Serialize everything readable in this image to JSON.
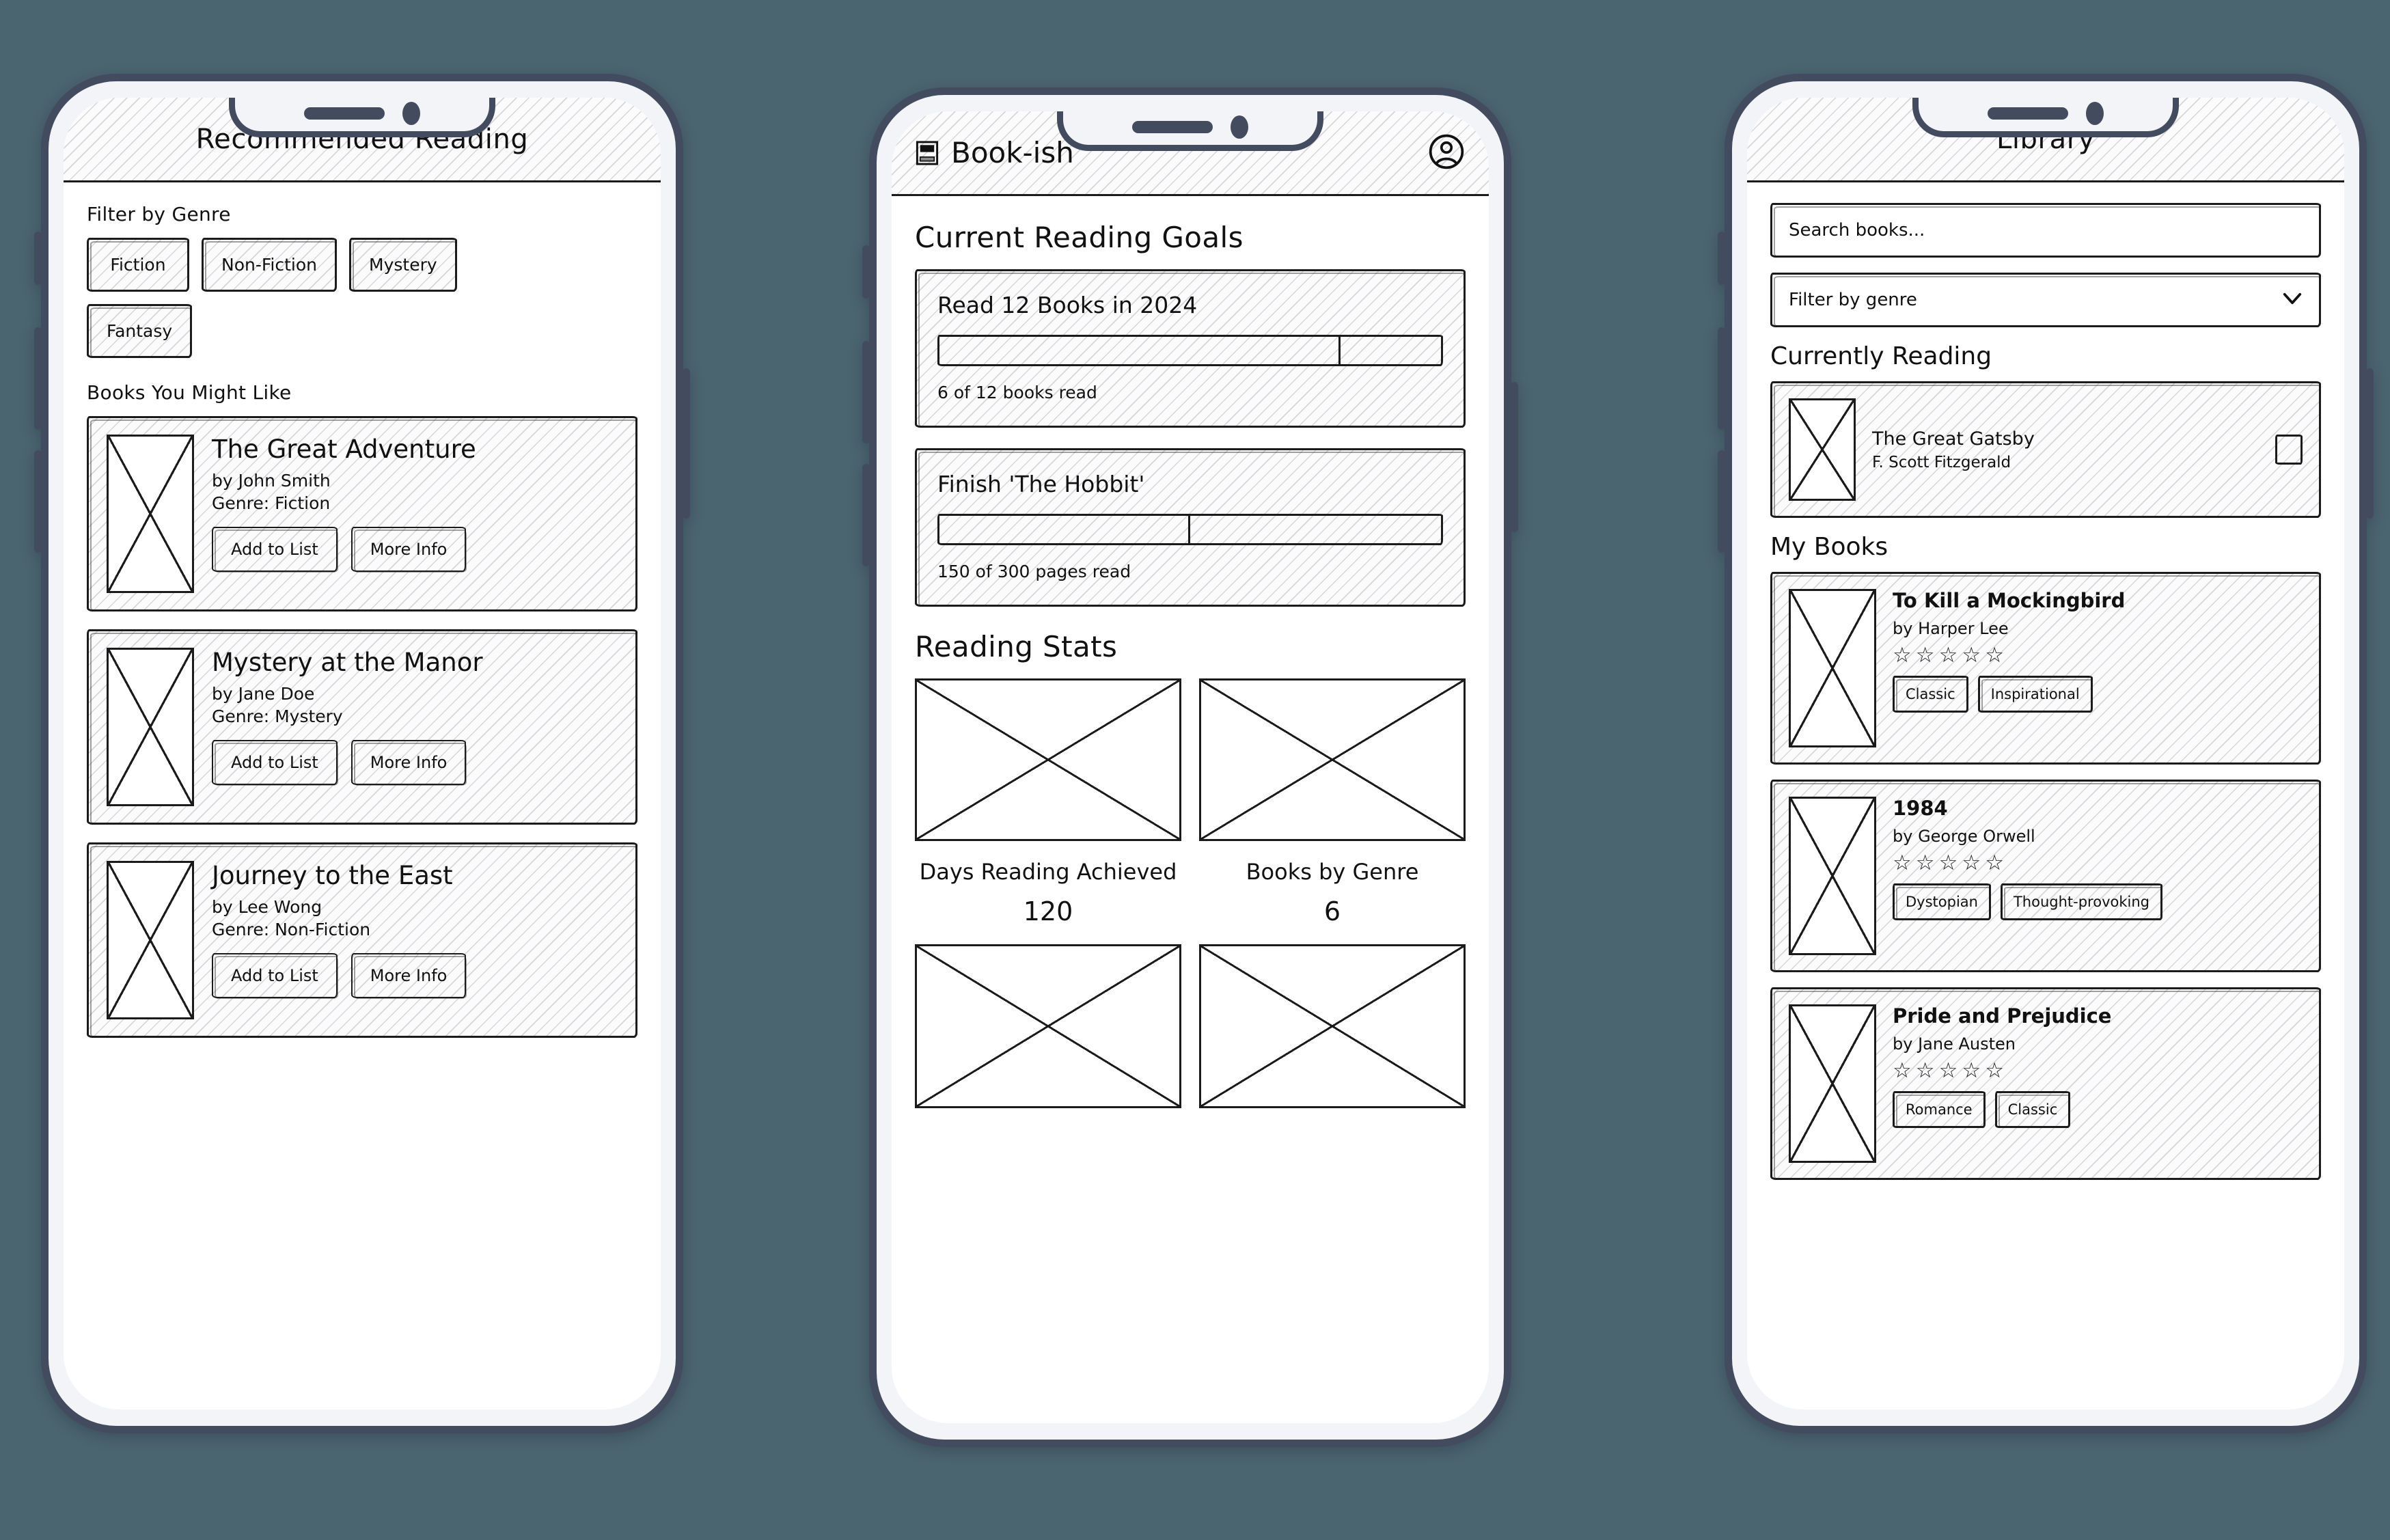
{
  "phone_recommended": {
    "header": {
      "title": "Recommended Reading"
    },
    "filter_label": "Filter by Genre",
    "genres": [
      {
        "label": "Fiction"
      },
      {
        "label": "Non-Fiction"
      },
      {
        "label": "Mystery"
      },
      {
        "label": "Fantasy"
      }
    ],
    "books_section_label": "Books You Might Like",
    "books": [
      {
        "title": "The Great Adventure",
        "author": "by John Smith",
        "genre": "Genre: Fiction",
        "add_label": "Add to List",
        "info_label": "More Info"
      },
      {
        "title": "Mystery at the Manor",
        "author": "by Jane Doe",
        "genre": "Genre: Mystery",
        "add_label": "Add to List",
        "info_label": "More Info"
      },
      {
        "title": "Journey to the East",
        "author": "by Lee Wong",
        "genre": "Genre: Non-Fiction",
        "add_label": "Add to List",
        "info_label": "More Info"
      }
    ]
  },
  "phone_goals": {
    "header": {
      "app_name": "Book-ish",
      "logo_icon": "book-icon",
      "avatar_icon": "user-avatar-icon"
    },
    "goals_heading": "Current Reading Goals",
    "goals": [
      {
        "title": "Read 12 Books in 2024",
        "progress_percent": 80,
        "status": "6 of 12 books read"
      },
      {
        "title": "Finish 'The Hobbit'",
        "progress_percent": 50,
        "status": "150 of 300 pages read"
      }
    ],
    "stats_heading": "Reading Stats",
    "stats": [
      {
        "label": "Days Reading Achieved",
        "value": "120"
      },
      {
        "label": "Books by Genre",
        "value": "6"
      }
    ]
  },
  "phone_library": {
    "header": {
      "title": "Library"
    },
    "search": {
      "placeholder": "Search books..."
    },
    "genre_filter": {
      "value": "Filter by genre",
      "chevron_icon": "chevron-down-icon"
    },
    "currently_reading_label": "Currently Reading",
    "currently_reading": {
      "title": "The Great Gatsby",
      "author": "F. Scott Fitzgerald",
      "checkbox_checked": false
    },
    "my_books_label": "My Books",
    "my_books": [
      {
        "title": "To Kill a Mockingbird",
        "author": "by Harper Lee",
        "rating": 0,
        "max_rating": 5,
        "tags": [
          "Classic",
          "Inspirational"
        ]
      },
      {
        "title": "1984",
        "author": "by George Orwell",
        "rating": 0,
        "max_rating": 5,
        "tags": [
          "Dystopian",
          "Thought-provoking"
        ]
      },
      {
        "title": "Pride and Prejudice",
        "author": "by Jane Austen",
        "rating": 0,
        "max_rating": 5,
        "tags": [
          "Romance",
          "Classic"
        ]
      }
    ]
  },
  "colors": {
    "page_background": "#4a6470",
    "phone_frame": "#434c5e",
    "phone_body": "#f2f4f7",
    "ink": "#1b1b1b",
    "screen": "#ffffff"
  },
  "icons": {
    "star_empty": "☆",
    "chevron_down": "⌄"
  }
}
